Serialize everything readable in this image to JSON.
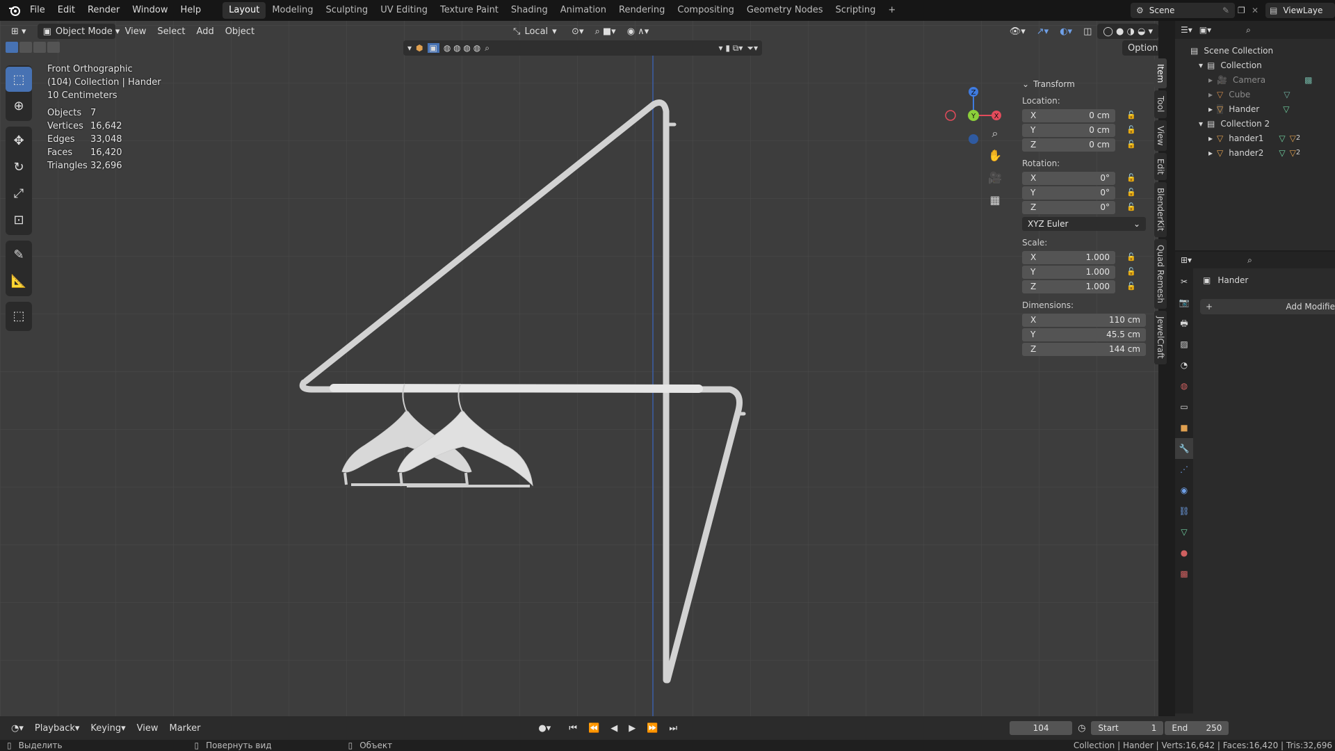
{
  "menu": [
    "File",
    "Edit",
    "Render",
    "Window",
    "Help"
  ],
  "workspaces": [
    "Layout",
    "Modeling",
    "Sculpting",
    "UV Editing",
    "Texture Paint",
    "Shading",
    "Animation",
    "Rendering",
    "Compositing",
    "Geometry Nodes",
    "Scripting"
  ],
  "workspace_active": "Layout",
  "scene_name": "Scene",
  "viewlayer_name": "ViewLaye",
  "viewport_header": {
    "mode": "Object Mode",
    "menus": [
      "View",
      "Select",
      "Add",
      "Object"
    ],
    "orientation": "Local",
    "options_label": "Options"
  },
  "overlay": {
    "view_name": "Front Orthographic",
    "collection_line": "(104) Collection | Hander",
    "scale_line": "10 Centimeters",
    "stats": [
      {
        "label": "Objects",
        "value": "7"
      },
      {
        "label": "Vertices",
        "value": "16,642"
      },
      {
        "label": "Edges",
        "value": "33,048"
      },
      {
        "label": "Faces",
        "value": "16,420"
      },
      {
        "label": "Triangles",
        "value": "32,696"
      }
    ]
  },
  "gizmo": {
    "x": "X",
    "y": "Y",
    "z": "Z"
  },
  "npanel": {
    "header": "Transform",
    "location_label": "Location:",
    "location": [
      {
        "axis": "X",
        "value": "0 cm"
      },
      {
        "axis": "Y",
        "value": "0 cm"
      },
      {
        "axis": "Z",
        "value": "0 cm"
      }
    ],
    "rotation_label": "Rotation:",
    "rotation": [
      {
        "axis": "X",
        "value": "0°"
      },
      {
        "axis": "Y",
        "value": "0°"
      },
      {
        "axis": "Z",
        "value": "0°"
      }
    ],
    "rotation_mode": "XYZ Euler",
    "scale_label": "Scale:",
    "scale": [
      {
        "axis": "X",
        "value": "1.000"
      },
      {
        "axis": "Y",
        "value": "1.000"
      },
      {
        "axis": "Z",
        "value": "1.000"
      }
    ],
    "dimensions_label": "Dimensions:",
    "dimensions": [
      {
        "axis": "X",
        "value": "110 cm"
      },
      {
        "axis": "Y",
        "value": "45.5 cm"
      },
      {
        "axis": "Z",
        "value": "144 cm"
      }
    ]
  },
  "side_tabs": [
    "Item",
    "Tool",
    "View",
    "Edit",
    "BlenderKit",
    "Quad Remesh",
    "JewelCraft"
  ],
  "outliner": {
    "root": "Scene Collection",
    "collection1": "Collection",
    "items1": [
      "Camera",
      "Cube",
      "Hander"
    ],
    "collection2": "Collection 2",
    "items2": [
      "hander1",
      "hander2"
    ],
    "badge": "2"
  },
  "properties": {
    "object_name": "Hander",
    "add_modifier": "Add Modifie"
  },
  "timeline": {
    "menus": [
      "Playback",
      "Keying",
      "View",
      "Marker"
    ],
    "current_frame": "104",
    "start_label": "Start",
    "start_value": "1",
    "end_label": "End",
    "end_value": "250"
  },
  "statusbar": {
    "left1": "Выделить",
    "left2": "Повернуть вид",
    "left3": "Объект",
    "right": "Collection | Hander | Verts:16,642 | Faces:16,420 | Tris:32,696"
  }
}
